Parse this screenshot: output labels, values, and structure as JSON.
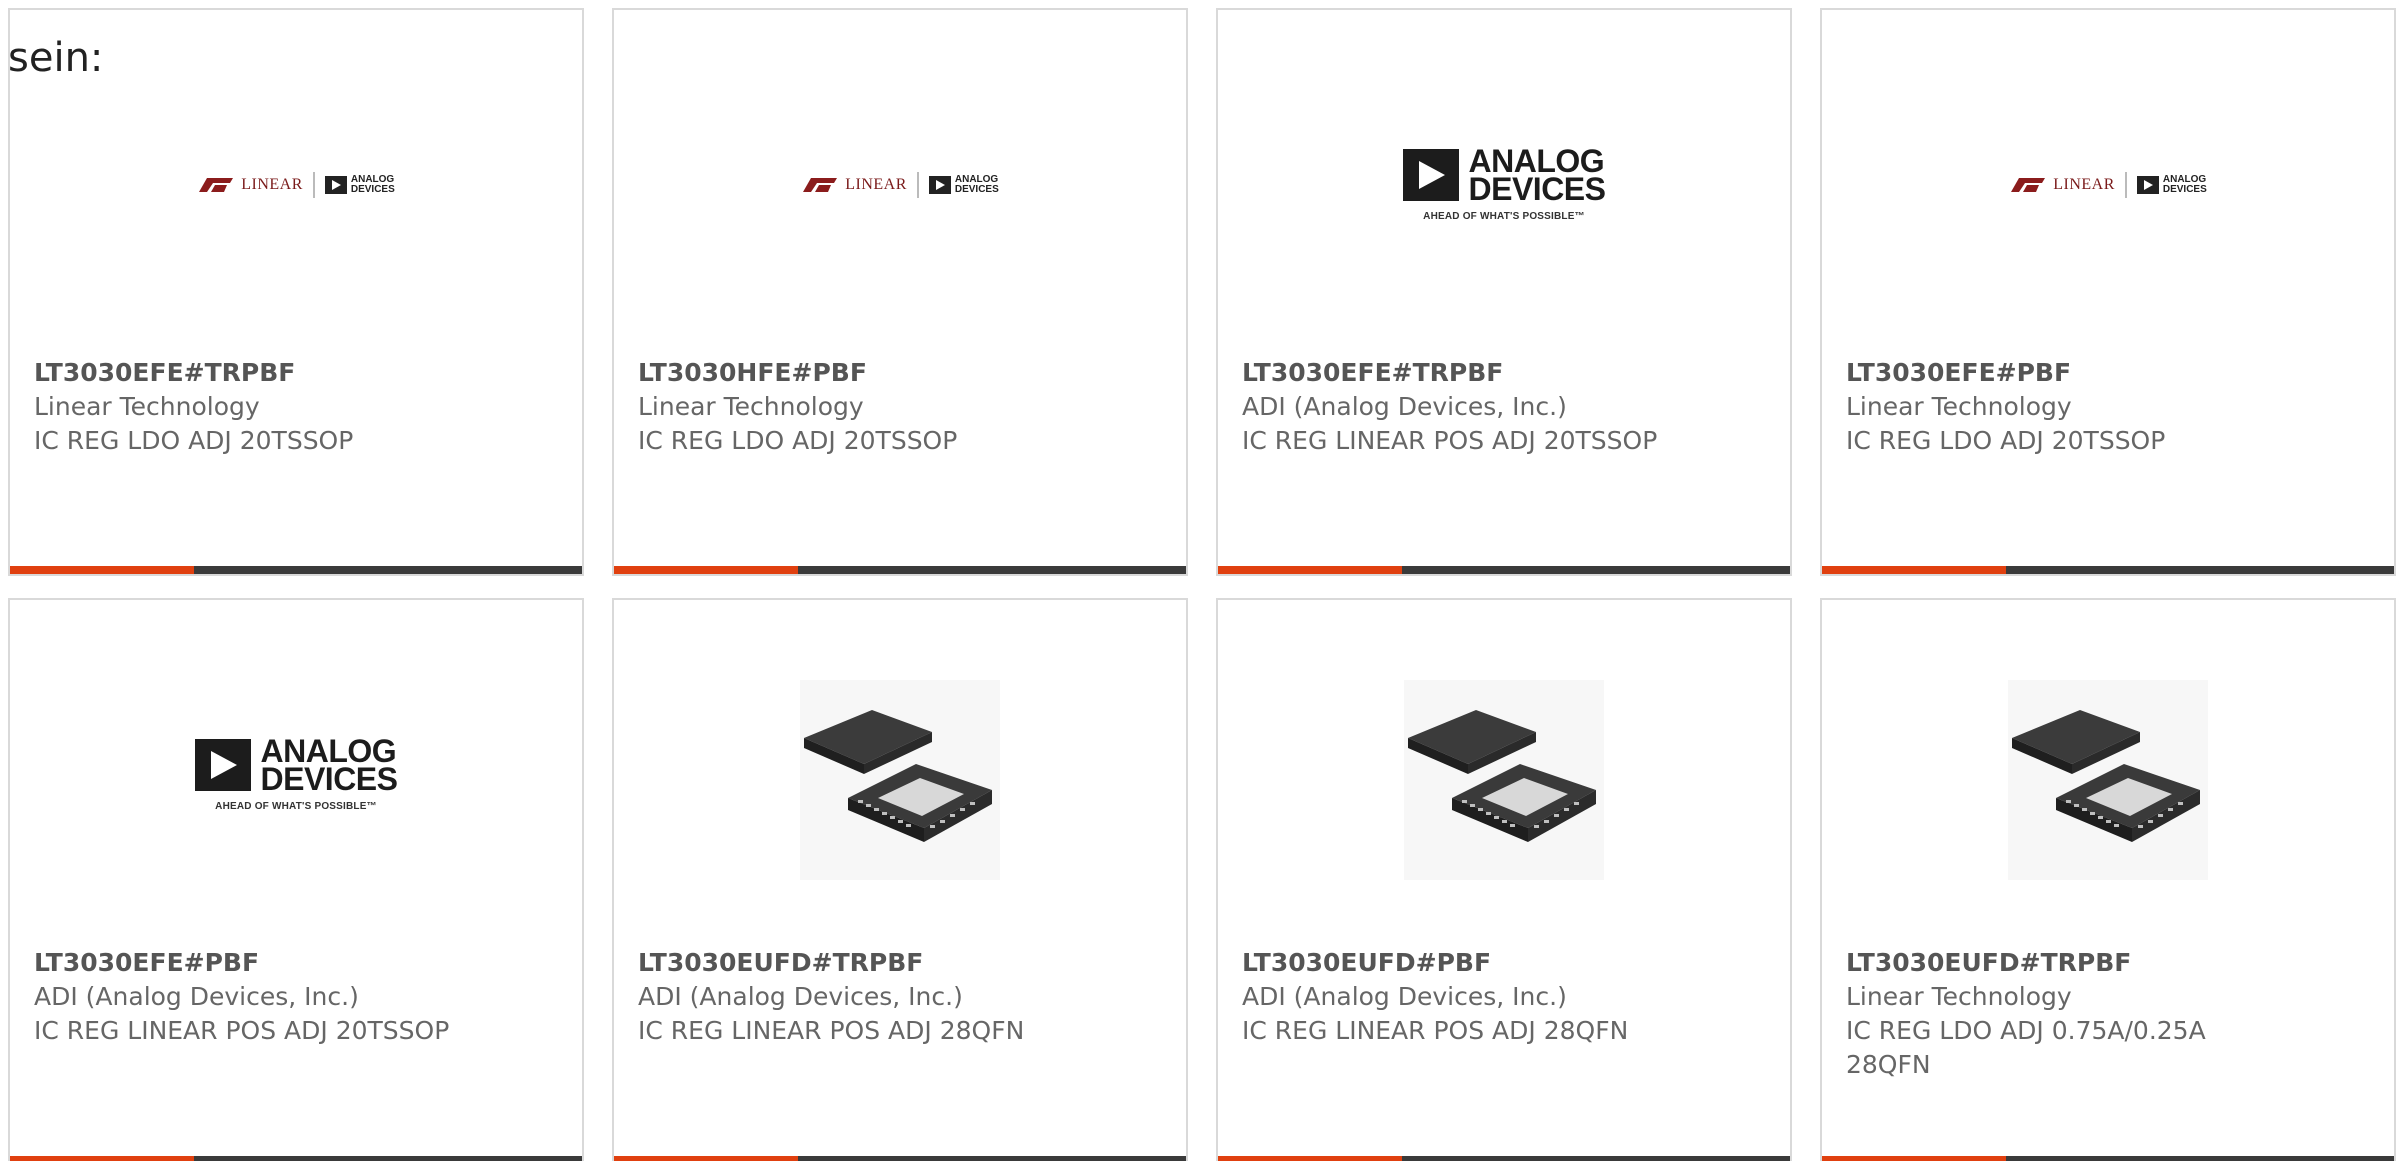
{
  "intro_text": "sein:",
  "colors": {
    "accent": "#e0400f",
    "bar": "#3a3a3a",
    "border": "#d9d9d9"
  },
  "logos": {
    "linear_word": "LINEAR",
    "adi_top": "ANALOG",
    "adi_bottom": "DEVICES",
    "adi_tagline": "AHEAD OF WHAT'S POSSIBLE™"
  },
  "cards": [
    {
      "part": "LT3030EFE#TRPBF",
      "manufacturer": "Linear Technology",
      "description": "IC REG LDO ADJ 20TSSOP",
      "image": "linear-adi-logo"
    },
    {
      "part": "LT3030HFE#PBF",
      "manufacturer": "Linear Technology",
      "description": "IC REG LDO ADJ 20TSSOP",
      "image": "linear-adi-logo"
    },
    {
      "part": "LT3030EFE#TRPBF",
      "manufacturer": "ADI (Analog Devices, Inc.)",
      "description": "IC REG LINEAR POS ADJ 20TSSOP",
      "image": "adi-logo"
    },
    {
      "part": "LT3030EFE#PBF",
      "manufacturer": "Linear Technology",
      "description": "IC REG LDO ADJ 20TSSOP",
      "image": "linear-adi-logo"
    },
    {
      "part": "LT3030EFE#PBF",
      "manufacturer": "ADI (Analog Devices, Inc.)",
      "description": "IC REG LINEAR POS ADJ 20TSSOP",
      "image": "adi-logo"
    },
    {
      "part": "LT3030EUFD#TRPBF",
      "manufacturer": "ADI (Analog Devices, Inc.)",
      "description": "IC REG LINEAR POS ADJ 28QFN",
      "image": "qfn-chip"
    },
    {
      "part": "LT3030EUFD#PBF",
      "manufacturer": "ADI (Analog Devices, Inc.)",
      "description": "IC REG LINEAR POS ADJ 28QFN",
      "image": "qfn-chip"
    },
    {
      "part": "LT3030EUFD#TRPBF",
      "manufacturer": "Linear Technology",
      "description": "IC REG LDO ADJ 0.75A/0.25A 28QFN",
      "image": "qfn-chip"
    }
  ]
}
